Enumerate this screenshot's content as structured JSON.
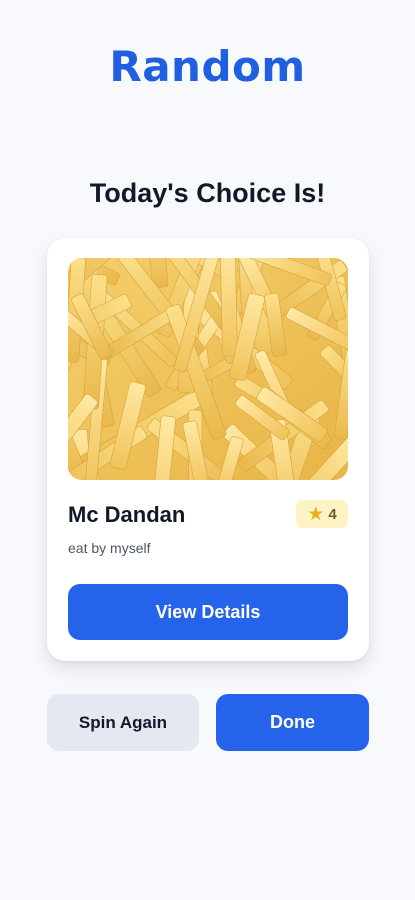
{
  "header": {
    "title": "Random",
    "subtitle": "Today's Choice Is!"
  },
  "card": {
    "image_icon": "french-fries-photo",
    "name": "Mc Dandan",
    "rating": "4",
    "rating_icon": "star-icon",
    "note": "eat by myself",
    "details_label": "View Details"
  },
  "actions": {
    "spin_again_label": "Spin Again",
    "done_label": "Done"
  },
  "colors": {
    "accent": "#2563eb",
    "title": "#1f5fe0",
    "badge_bg": "#fdf3c4",
    "star": "#e8b01a",
    "secondary_btn": "#e4e9f1"
  }
}
